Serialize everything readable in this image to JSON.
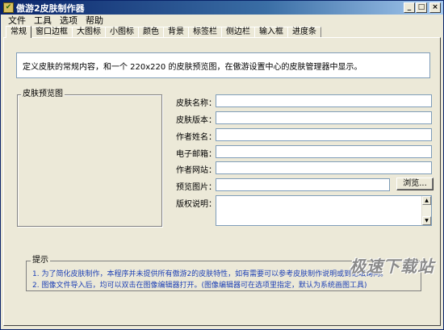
{
  "window": {
    "title": "傲游2皮肤制作器",
    "buttons": {
      "minimize": "_",
      "maximize": "□",
      "close": "×"
    }
  },
  "menu": [
    "文件",
    "工具",
    "选项",
    "帮助"
  ],
  "tabs": [
    "常规",
    "窗口边框",
    "大图标",
    "小图标",
    "颜色",
    "背景",
    "标签栏",
    "侧边栏",
    "输入框",
    "进度条"
  ],
  "active_tab": "常规",
  "description": "定义皮肤的常规内容，和一个 220x220 的皮肤预览图，在傲游设置中心的皮肤管理器中显示。",
  "preview": {
    "label": "皮肤预览图"
  },
  "form": {
    "skin_name": {
      "label": "皮肤名称：",
      "value": ""
    },
    "skin_version": {
      "label": "皮肤版本：",
      "value": ""
    },
    "author_name": {
      "label": "作者姓名：",
      "value": ""
    },
    "email": {
      "label": "电子邮箱：",
      "value": ""
    },
    "author_site": {
      "label": "作者网站：",
      "value": ""
    },
    "preview_image": {
      "label": "预览图片：",
      "value": "",
      "browse": "浏览..."
    },
    "copyright": {
      "label": "版权说明：",
      "value": ""
    }
  },
  "tips": {
    "label": "提示",
    "items": [
      "1. 为了简化皮肤制作，本程序并未提供所有傲游2的皮肤特性，如有需要可以参考皮肤制作说明或到论坛询问。",
      "2. 图像文件导入后，均可以双击在图像编辑器打开。(图像编辑器可在选项里指定，默认为系统画图工具)"
    ]
  },
  "watermark": "极速下载站",
  "colors": {
    "tip_text": "#1c3fb5",
    "title_bar": "#0a246a",
    "face": "#ece9d8"
  }
}
